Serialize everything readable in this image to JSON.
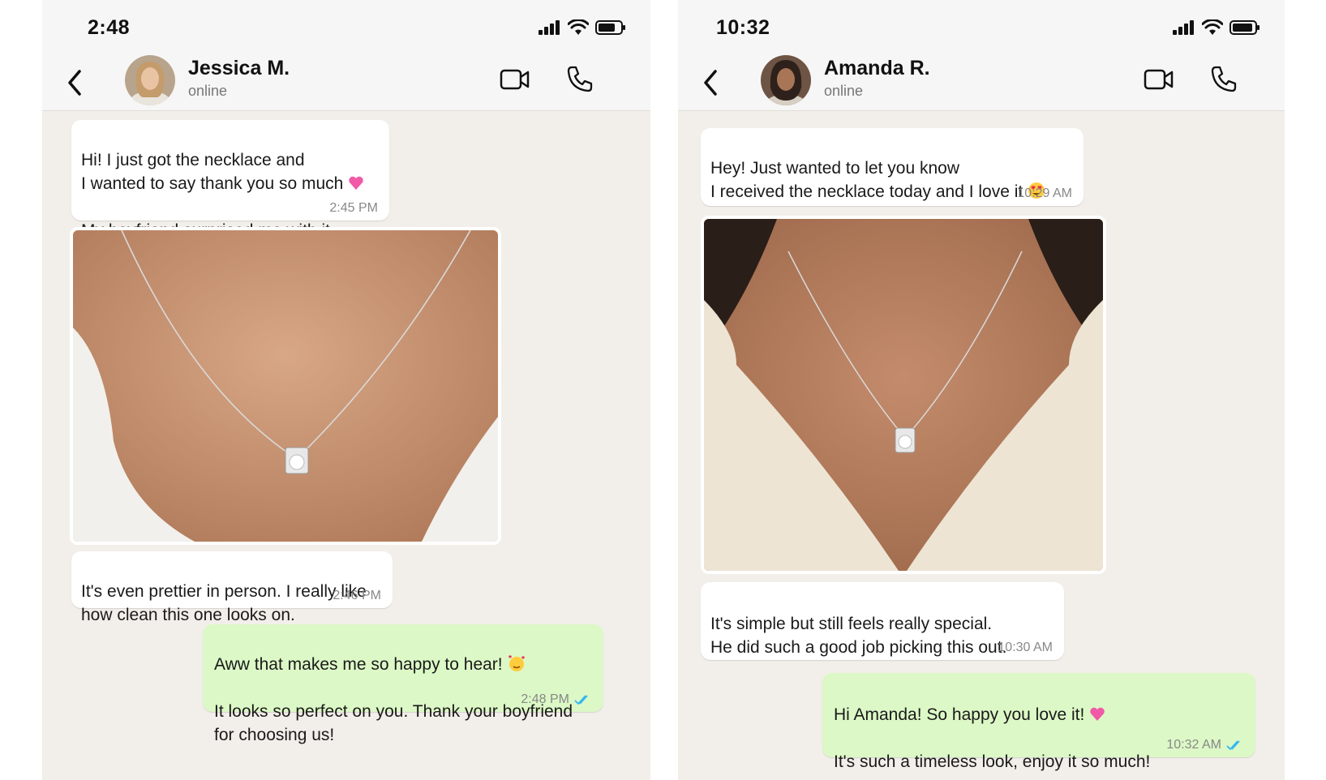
{
  "left": {
    "status_time": "2:48",
    "contact_name": "Jessica M.",
    "contact_status": "online",
    "messages": [
      {
        "text": "Hi! I just got the necklace and\nI wanted to say thank you so much",
        "text2": "My boyfriend surprised me with it\nfor our anniversary.",
        "time": "2:45 PM",
        "emoji": "heart"
      },
      {
        "text": "It's even prettier in person. I really like\nhow clean this one looks on.",
        "time": "2:46 PM"
      },
      {
        "text": "Aww that makes me so happy to hear!",
        "text2": "It looks so perfect on you. Thank your boyfriend\nfor choosing us!",
        "time": "2:48 PM",
        "emoji": "smiling-hearts"
      }
    ]
  },
  "right": {
    "status_time": "10:32",
    "contact_name": "Amanda R.",
    "contact_status": "online",
    "messages": [
      {
        "text": "Hey! Just wanted to let you know\nI received the necklace today and I love it",
        "time": "10:29 AM",
        "emoji": "heart-eyes"
      },
      {
        "text": "It's simple but still feels really special.\nHe did such a good job picking this out.",
        "time": "10:30 AM"
      },
      {
        "text": "Hi Amanda! So happy you love it!",
        "text2": "It's such a timeless look, enjoy it so much!",
        "time": "10:32 AM",
        "emoji": "heart"
      }
    ]
  },
  "colors": {
    "incoming": "#ffffff",
    "outgoing": "#dcf8c6",
    "read_tick": "#34b7f1",
    "wallpaper": "#f2efea"
  },
  "icons": [
    "back-chevron-icon",
    "video-call-icon",
    "phone-call-icon",
    "signal-icon",
    "wifi-icon",
    "battery-icon",
    "double-check-icon"
  ]
}
